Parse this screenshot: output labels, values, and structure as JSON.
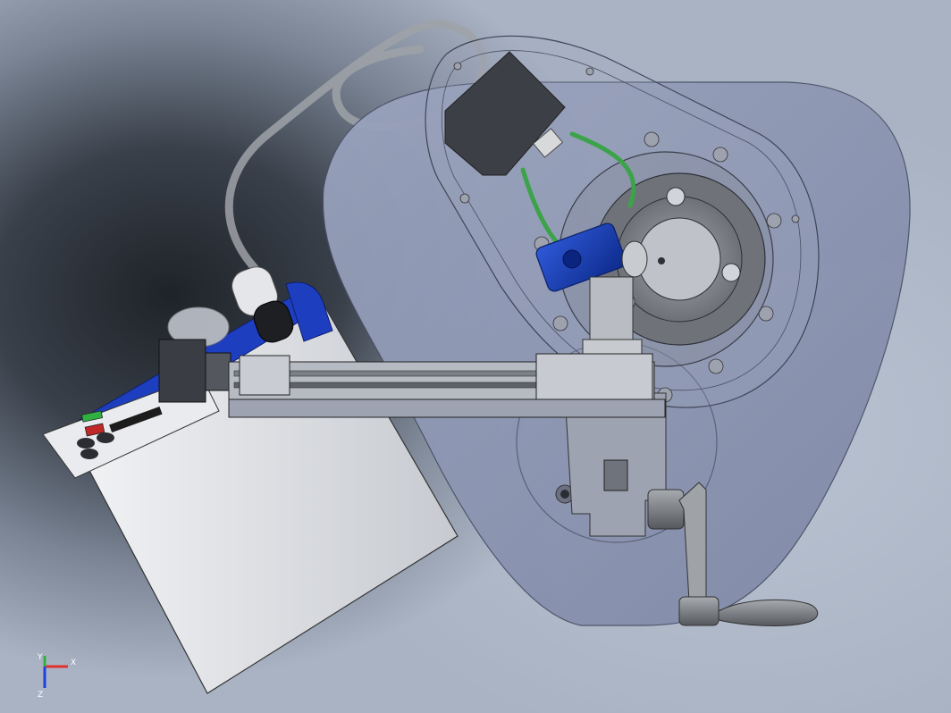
{
  "view": {
    "background_colors": {
      "dark": "#1f2329",
      "light": "#c9d1dc"
    },
    "part_colors": {
      "base_plate": "#8a94b0",
      "housing_light": "#d9dce2",
      "accent_blue": "#123bb0",
      "motor_dark": "#3c3f45",
      "belt_green": "#3da34a",
      "flange_gray": "#7c7f85"
    }
  },
  "axis_triad": {
    "x_label": "X",
    "y_label": "Y",
    "z_label": "Z",
    "x_color": "#e03030",
    "y_color": "#2fb040",
    "z_color": "#2040e0"
  }
}
